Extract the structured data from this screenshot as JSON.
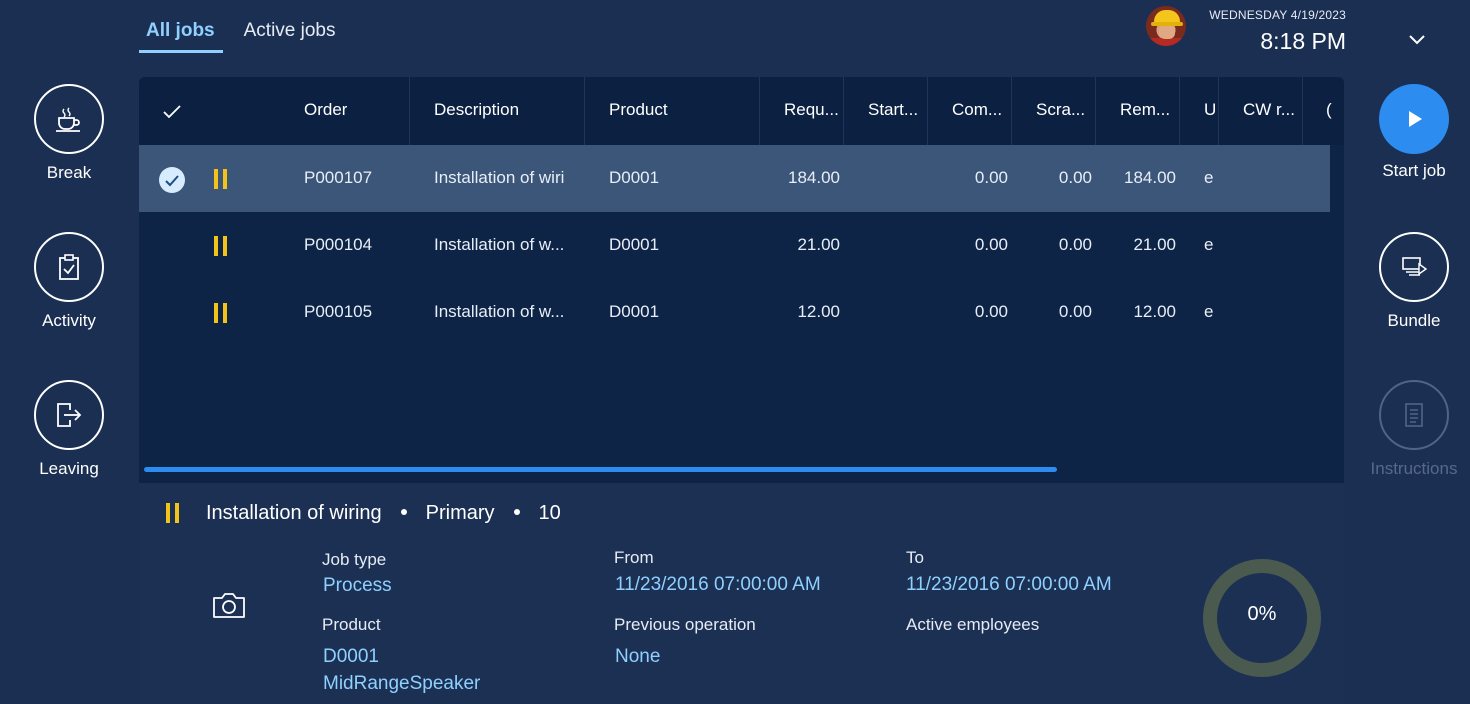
{
  "tabs": [
    {
      "label": "All jobs",
      "active": true
    },
    {
      "label": "Active jobs",
      "active": false
    }
  ],
  "header": {
    "date": "WEDNESDAY 4/19/2023",
    "time": "8:18 PM",
    "expand_icon": "chevron-down-icon"
  },
  "left_actions": [
    {
      "label": "Break",
      "icon": "coffee-cup-icon"
    },
    {
      "label": "Activity",
      "icon": "clipboard-check-icon"
    },
    {
      "label": "Leaving",
      "icon": "exit-door-icon"
    }
  ],
  "right_actions": [
    {
      "label": "Start job",
      "icon": "play-icon",
      "state": "primary"
    },
    {
      "label": "Bundle",
      "icon": "bundle-icon",
      "state": "enabled"
    },
    {
      "label": "Instructions",
      "icon": "document-icon",
      "state": "disabled"
    }
  ],
  "grid": {
    "columns": [
      "Order",
      "Description",
      "Product",
      "Requ...",
      "Start...",
      "Com...",
      "Scra...",
      "Rem...",
      "U",
      "CW r...",
      "("
    ],
    "rows": [
      {
        "selected": true,
        "status": "paused",
        "order": "P000107",
        "description": "Installation of wiri",
        "product": "D0001",
        "required": "184.00",
        "started": "",
        "completed": "0.00",
        "scrapped": "0.00",
        "remaining": "184.00",
        "unit": "e",
        "cw": ""
      },
      {
        "selected": false,
        "status": "paused",
        "order": "P000104",
        "description": "Installation of w...",
        "product": "D0001",
        "required": "21.00",
        "started": "",
        "completed": "0.00",
        "scrapped": "0.00",
        "remaining": "21.00",
        "unit": "e",
        "cw": ""
      },
      {
        "selected": false,
        "status": "paused",
        "order": "P000105",
        "description": "Installation of w...",
        "product": "D0001",
        "required": "12.00",
        "started": "",
        "completed": "0.00",
        "scrapped": "0.00",
        "remaining": "12.00",
        "unit": "e",
        "cw": ""
      }
    ]
  },
  "details": {
    "title": "Installation of wiring",
    "priority": "Primary",
    "number": "10",
    "job_type_label": "Job type",
    "job_type_value": "Process",
    "from_label": "From",
    "from_value": "11/23/2016 07:00:00 AM",
    "to_label": "To",
    "to_value": "11/23/2016 07:00:00 AM",
    "product_label": "Product",
    "product_id": "D0001",
    "product_name": "MidRangeSpeaker",
    "previous_op_label": "Previous operation",
    "previous_op_value": "None",
    "active_employees_label": "Active employees",
    "progress": "0%"
  },
  "colors": {
    "background": "#1b2f52",
    "grid_background": "#0d2446",
    "accent": "#2d8cf0",
    "link": "#8fd0ff",
    "paused": "#f2c318",
    "progress_ring": "#4a5a4f"
  }
}
